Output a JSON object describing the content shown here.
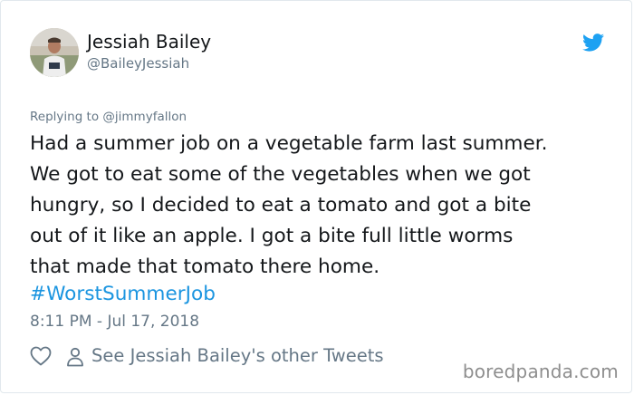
{
  "author": {
    "display_name": "Jessiah Bailey",
    "handle": "@BaileyJessiah",
    "avatar": "profile-photo"
  },
  "reply": {
    "prefix": "Replying to ",
    "target": "@jimmyfallon"
  },
  "tweet": {
    "text": "Had a summer job on a vegetable farm last summer.\nWe got to eat some of the vegetables when we got\nhungry, so I decided to eat a tomato and got a bite\nout of it like an apple. I got a bite full little worms\nthat made that tomato there home.",
    "hashtag": "#WorstSummerJob",
    "timestamp": "8:11 PM - Jul 17, 2018"
  },
  "actions": {
    "like_icon": "heart-icon",
    "profile_icon": "person-icon",
    "other_tweets_label": "See Jessiah Bailey's other Tweets"
  },
  "watermark": "boredpanda.com",
  "colors": {
    "brand": "#1da1f2",
    "link": "#1b95e0",
    "secondary_text": "#657786",
    "primary_text": "#14171a"
  }
}
